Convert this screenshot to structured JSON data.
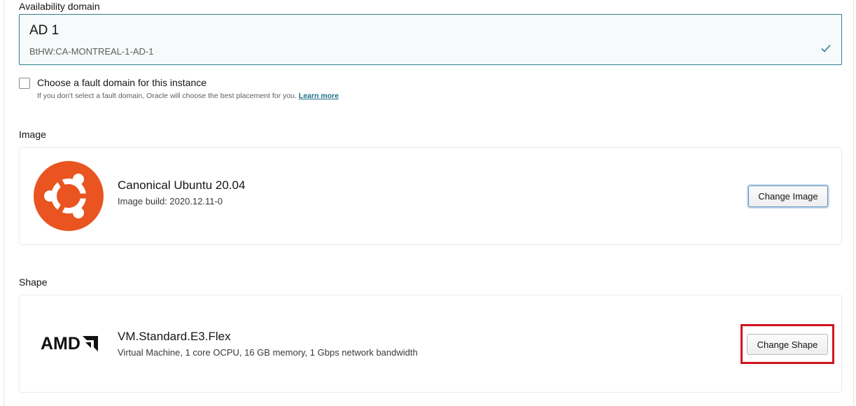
{
  "availability_domain": {
    "label": "Availability domain",
    "selected_title": "AD 1",
    "selected_subtitle": "BtHW:CA-MONTREAL-1-AD-1",
    "selected_icon": "check-icon"
  },
  "fault_domain": {
    "checkbox_label": "Choose a fault domain for this instance",
    "checked": false,
    "help_text": "If you don't select a fault domain, Oracle will choose the best placement for you.",
    "learn_more": "Learn more"
  },
  "image": {
    "section_label": "Image",
    "logo": "ubuntu-logo",
    "logo_color": "#e95420",
    "name": "Canonical Ubuntu 20.04",
    "build": "Image build: 2020.12.11-0",
    "change_button": "Change Image"
  },
  "shape": {
    "section_label": "Shape",
    "logo": "amd-logo",
    "logo_text": "AMD",
    "name": "VM.Standard.E3.Flex",
    "description": "Virtual Machine, 1 core OCPU, 16 GB memory, 1 Gbps network bandwidth",
    "change_button": "Change Shape",
    "highlight_color": "#d1141f"
  }
}
